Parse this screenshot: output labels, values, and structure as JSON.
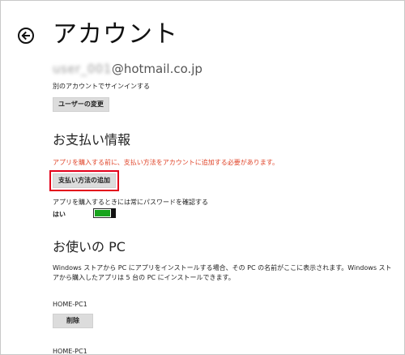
{
  "header": {
    "title": "アカウント"
  },
  "account": {
    "email_masked": "user_001",
    "email_domain": "@hotmail.co.jp",
    "signin_other_text": "別のアカウントでサインインする",
    "change_user_label": "ユーザーの変更"
  },
  "payment": {
    "title": "お支払い情報",
    "warning_text": "アプリを購入する前に、支払い方法をアカウントに追加する必要があります。",
    "add_method_label": "支払い方法の追加",
    "password_text": "アプリを購入するときには常にパスワードを確認する",
    "toggle_state_label": "はい",
    "toggle_on": true
  },
  "pcs": {
    "title": "お使いの PC",
    "description": "Windows ストアから PC にアプリをインストールする場合、その PC の名前がここに表示されます。Windows ストアから購入したアプリは 5 台の PC にインストールできます。",
    "items": [
      {
        "name": "HOME-PC1",
        "action_label": "削除"
      },
      {
        "name": "HOME-PC1"
      }
    ]
  },
  "colors": {
    "warning": "#e0452a",
    "toggle_on": "#18a41d",
    "highlight": "#e3001b"
  },
  "icons": {
    "back": "back-arrow-circle-icon"
  }
}
